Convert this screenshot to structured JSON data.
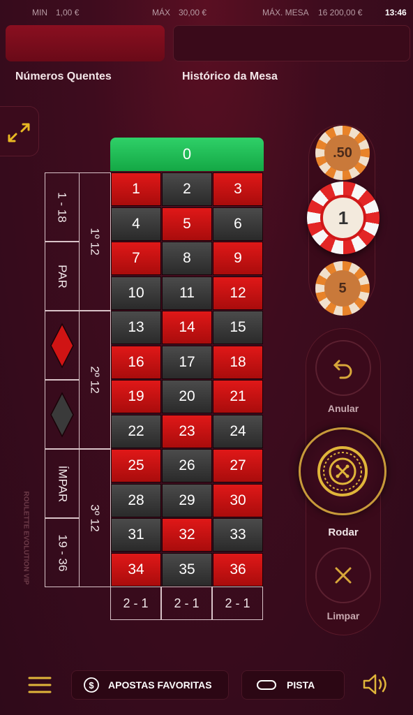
{
  "topbar": {
    "min_label": "MIN",
    "min_value": "1,00 €",
    "max_label": "MÁX",
    "max_value": "30,00 €",
    "table_max_label": "MÁX. MESA",
    "table_max_value": "16 200,00 €",
    "time": "13:46"
  },
  "labels": {
    "hot_numbers": "Números Quentes",
    "table_history": "Histórico da Mesa"
  },
  "board": {
    "zero": "0",
    "numbers": [
      [
        "1",
        "red"
      ],
      [
        "2",
        "black"
      ],
      [
        "3",
        "red"
      ],
      [
        "4",
        "black"
      ],
      [
        "5",
        "red"
      ],
      [
        "6",
        "black"
      ],
      [
        "7",
        "red"
      ],
      [
        "8",
        "black"
      ],
      [
        "9",
        "red"
      ],
      [
        "10",
        "black"
      ],
      [
        "11",
        "black"
      ],
      [
        "12",
        "red"
      ],
      [
        "13",
        "black"
      ],
      [
        "14",
        "red"
      ],
      [
        "15",
        "black"
      ],
      [
        "16",
        "red"
      ],
      [
        "17",
        "black"
      ],
      [
        "18",
        "red"
      ],
      [
        "19",
        "red"
      ],
      [
        "20",
        "black"
      ],
      [
        "21",
        "red"
      ],
      [
        "22",
        "black"
      ],
      [
        "23",
        "red"
      ],
      [
        "24",
        "black"
      ],
      [
        "25",
        "red"
      ],
      [
        "26",
        "black"
      ],
      [
        "27",
        "red"
      ],
      [
        "28",
        "black"
      ],
      [
        "29",
        "black"
      ],
      [
        "30",
        "red"
      ],
      [
        "31",
        "black"
      ],
      [
        "32",
        "red"
      ],
      [
        "33",
        "black"
      ],
      [
        "34",
        "red"
      ],
      [
        "35",
        "black"
      ],
      [
        "36",
        "red"
      ]
    ],
    "columns": [
      "2 - 1",
      "2 - 1",
      "2 - 1"
    ],
    "dozens": [
      "1º 12",
      "2º 12",
      "3º 12"
    ],
    "even_money": [
      "1 - 18",
      "PAR",
      "red-diamond",
      "black-diamond",
      "ÍMPAR",
      "19 - 36"
    ],
    "colors": {
      "red": "#d01414",
      "black": "#3a3a3a",
      "green": "#1fb954"
    }
  },
  "chips": [
    ".50",
    "1",
    "5"
  ],
  "controls": {
    "undo": "Anular",
    "spin": "Rodar",
    "clear": "Limpar"
  },
  "side_text": "ROULETTE EVOLUTION VIP",
  "bottom": {
    "favorites": "APOSTAS FAVORITAS",
    "track": "PISTA"
  },
  "icons": {
    "expand": "expand-icon",
    "undo": "undo-icon",
    "spin": "roulette-wheel-icon",
    "clear": "close-icon",
    "menu": "menu-icon",
    "favorites": "dollar-icon",
    "track": "track-icon",
    "sound": "speaker-icon"
  }
}
